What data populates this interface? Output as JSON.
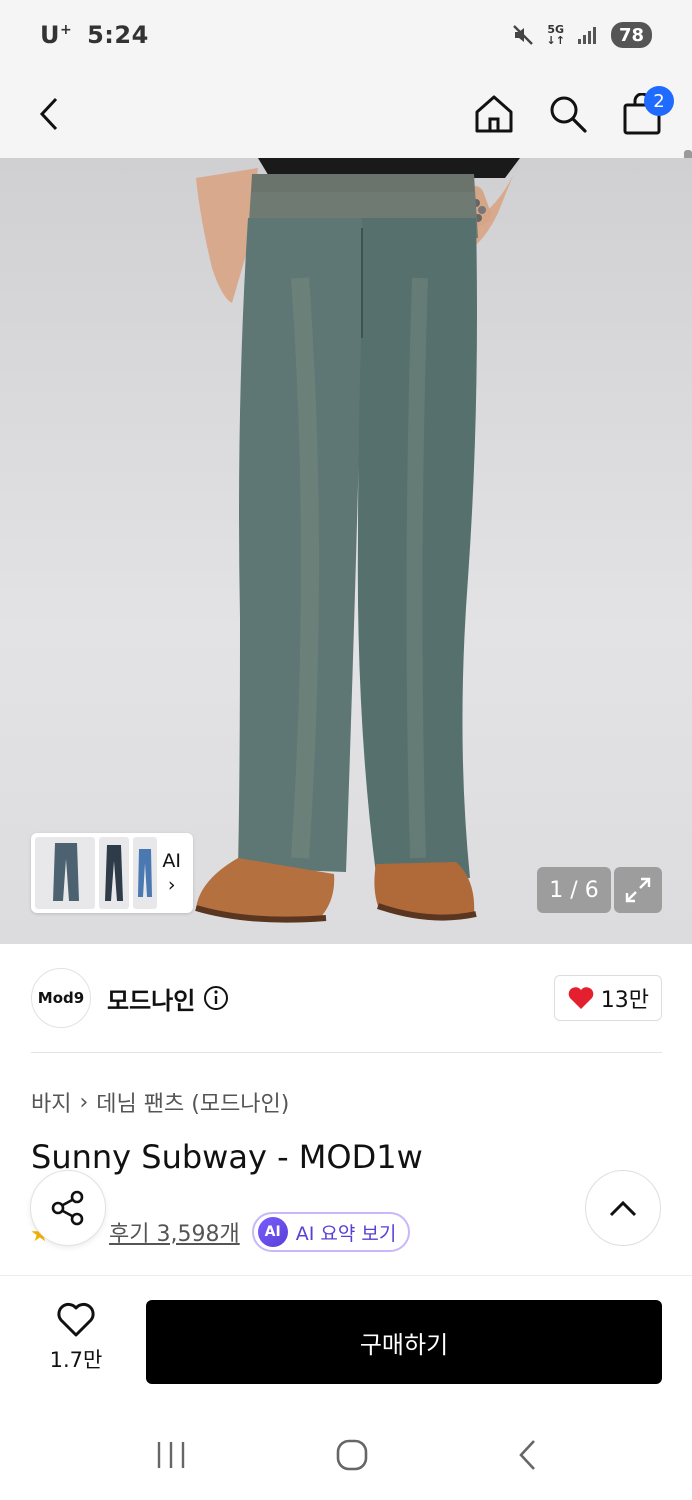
{
  "status_bar": {
    "carrier": "U",
    "carrier_sup": "+",
    "time": "5:24",
    "network_top": "5G",
    "network_bottom": "↓↑",
    "battery": "78"
  },
  "nav": {
    "cart_count": "2"
  },
  "gallery": {
    "counter": "1 / 6",
    "ai_label": "AI",
    "ai_arrow": "›",
    "image_description_icon": "jeans-photo"
  },
  "brand": {
    "logo_text": "Mod9",
    "name": "모드나인",
    "likes": "13만"
  },
  "product": {
    "breadcrumb": [
      "바지",
      "데님 팬츠 (모드나인)"
    ],
    "breadcrumb_sep": "›",
    "title": "Sunny Subway - MOD1w",
    "reviews": "후기 3,598개",
    "ai_badge": "AI",
    "ai_summary": "AI 요약 보기"
  },
  "bottom_bar": {
    "wish_count": "1.7만",
    "buy_label": "구매하기"
  },
  "colors": {
    "accent_blue": "#1f6bff",
    "heart_red": "#e5202e",
    "ai_purple": "#5a3fd6",
    "buy_black": "#000000"
  }
}
